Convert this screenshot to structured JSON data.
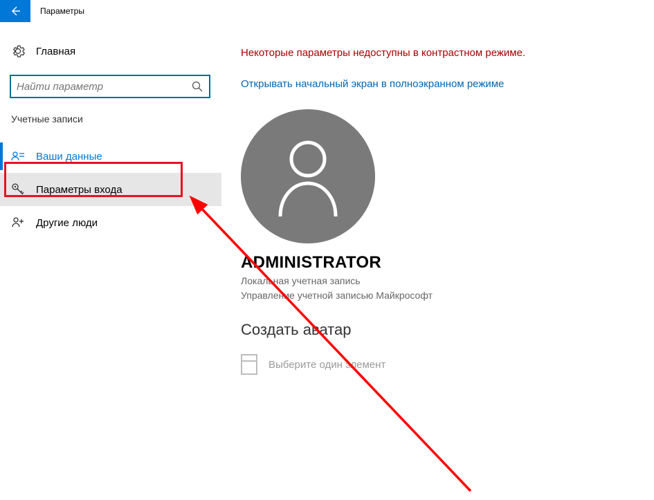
{
  "titlebar": {
    "title": "Параметры"
  },
  "sidebar": {
    "home_label": "Главная",
    "search_placeholder": "Найти параметр",
    "section_label": "Учетные записи",
    "items": [
      {
        "label": "Ваши данные"
      },
      {
        "label": "Параметры входа"
      },
      {
        "label": "Другие люди"
      }
    ]
  },
  "main": {
    "warning": "Некоторые параметры недоступны в контрастном режиме.",
    "link": "Открывать начальный экран в полноэкранном режиме",
    "user_name": "ADMINISTRATOR",
    "user_subtitle1": "Локальная учетная запись",
    "user_subtitle2": "Управление учетной записью Майкрософт",
    "create_avatar_heading": "Создать аватар",
    "picker_label": "Выберите один элемент"
  },
  "colors": {
    "accent": "#0078d7",
    "warning": "#a80000",
    "link": "#0066b4",
    "highlight": "#e81123"
  }
}
